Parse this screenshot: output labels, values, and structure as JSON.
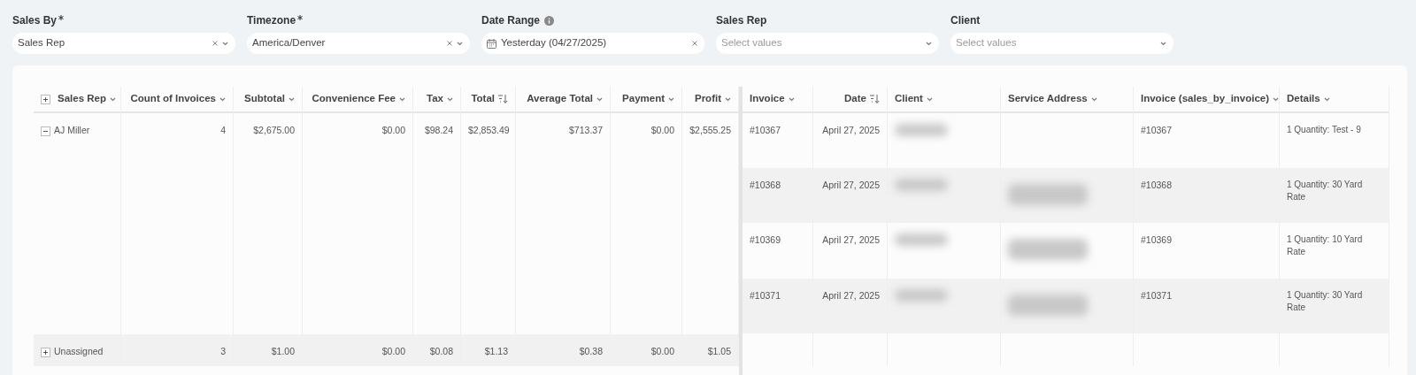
{
  "filters": [
    {
      "label": "Sales By",
      "required": true,
      "kind": "select",
      "value": "Sales Rep",
      "clearable": true
    },
    {
      "label": "Timezone",
      "required": true,
      "kind": "select",
      "value": "America/Denver",
      "clearable": true
    },
    {
      "label": "Date Range",
      "required": false,
      "info": true,
      "kind": "date",
      "value": "Yesterday (04/27/2025)",
      "clearable": true
    },
    {
      "label": "Sales Rep",
      "required": false,
      "kind": "select",
      "placeholder": "Select values",
      "clearable": false
    },
    {
      "label": "Client",
      "required": false,
      "kind": "select",
      "placeholder": "Select values",
      "clearable": false
    }
  ],
  "summary_table": {
    "columns": [
      {
        "label": "Sales Rep",
        "sorted": false,
        "expand_all": true
      },
      {
        "label": "Count of Invoices",
        "sorted": false
      },
      {
        "label": "Subtotal",
        "sorted": false
      },
      {
        "label": "Convenience Fee",
        "sorted": false
      },
      {
        "label": "Tax",
        "sorted": false
      },
      {
        "label": "Total",
        "sorted": true
      },
      {
        "label": "Average Total",
        "sorted": false
      },
      {
        "label": "Payment",
        "sorted": false
      },
      {
        "label": "Profit",
        "sorted": false
      }
    ],
    "rows": [
      {
        "expanded": true,
        "cells": [
          "AJ Miller",
          "4",
          "$2,675.00",
          "$0.00",
          "$98.24",
          "$2,853.49",
          "$713.37",
          "$0.00",
          "$2,555.25"
        ]
      },
      {
        "expanded": false,
        "cells": [
          "Unassigned",
          "3",
          "$1.00",
          "$0.00",
          "$0.08",
          "$1.13",
          "$0.38",
          "$0.00",
          "$1.05"
        ]
      }
    ]
  },
  "detail_table": {
    "columns": [
      {
        "label": "Invoice",
        "sorted": false
      },
      {
        "label": "Date",
        "sorted": true
      },
      {
        "label": "Client",
        "sorted": false
      },
      {
        "label": "Service Address",
        "sorted": false
      },
      {
        "label": "Invoice (sales_by_invoice)",
        "sorted": false
      },
      {
        "label": "Details",
        "sorted": false
      }
    ],
    "rows": [
      {
        "invoice": "#10367",
        "date": "April 27, 2025",
        "client_blurred": true,
        "address_blurred": false,
        "invoice_ref": "#10367",
        "details": "1 Quantity: Test - 9"
      },
      {
        "invoice": "#10368",
        "date": "April 27, 2025",
        "client_blurred": true,
        "address_blurred": true,
        "invoice_ref": "#10368",
        "details": "1 Quantity: 30 Yard\nRate"
      },
      {
        "invoice": "#10369",
        "date": "April 27, 2025",
        "client_blurred": true,
        "address_blurred": true,
        "invoice_ref": "#10369",
        "details": "1 Quantity: 10 Yard\nRate"
      },
      {
        "invoice": "#10371",
        "date": "April 27, 2025",
        "client_blurred": true,
        "address_blurred": true,
        "invoice_ref": "#10371",
        "details": "1 Quantity: 30 Yard\nRate"
      }
    ]
  }
}
